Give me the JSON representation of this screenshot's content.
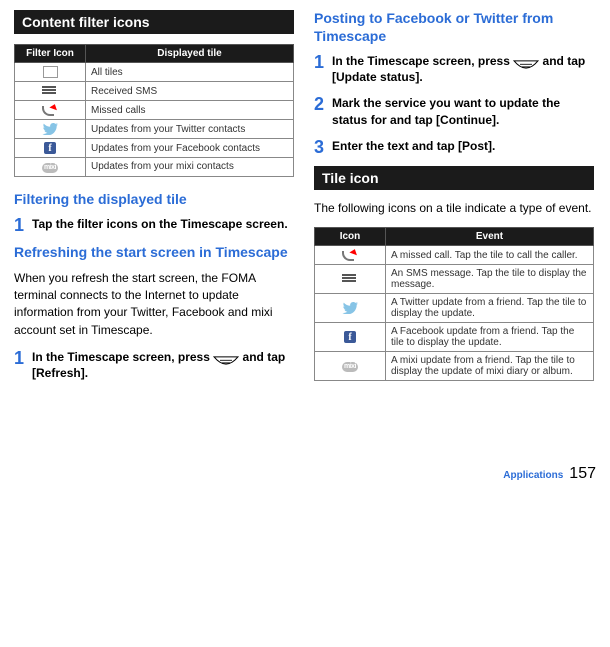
{
  "left": {
    "sectionBar": "Content filter icons",
    "table": {
      "headers": {
        "col1": "Filter Icon",
        "col2": "Displayed tile"
      },
      "rows": [
        {
          "icon": "all-tiles",
          "text": "All tiles"
        },
        {
          "icon": "sms",
          "text": "Received SMS"
        },
        {
          "icon": "missed",
          "text": "Missed calls"
        },
        {
          "icon": "twitter",
          "text": "Updates from your Twitter contacts"
        },
        {
          "icon": "facebook",
          "text": "Updates from your Facebook contacts"
        },
        {
          "icon": "mixi",
          "text": "Updates from your mixi contacts"
        }
      ]
    },
    "filtering": {
      "heading": "Filtering the displayed tile",
      "step1_num": "1",
      "step1_text": "Tap the filter icons on the Timescape screen."
    },
    "refreshing": {
      "heading": "Refreshing the start screen in Timescape",
      "body": "When you refresh the start screen, the FOMA terminal connects to the Internet to update information from your Twitter, Facebook and mixi account set in Timescape.",
      "step1_num": "1",
      "step1_pre": "In the Timescape screen, press ",
      "step1_post": " and tap [Refresh]."
    }
  },
  "right": {
    "posting": {
      "heading": "Posting to Facebook or Twitter from Timescape",
      "step1_num": "1",
      "step1_pre": "In the Timescape screen, press ",
      "step1_post": " and tap [Update status].",
      "step2_num": "2",
      "step2_text": "Mark the service you want to update the status for and tap [Continue].",
      "step3_num": "3",
      "step3_text": "Enter the text and tap [Post]."
    },
    "tileIcon": {
      "bar": "Tile icon",
      "body": "The following icons on a tile indicate a type of event.",
      "table": {
        "headers": {
          "col1": "Icon",
          "col2": "Event"
        },
        "rows": [
          {
            "icon": "missed",
            "text": "A missed call. Tap the tile to call the caller."
          },
          {
            "icon": "sms",
            "text": "An SMS message. Tap the tile to display the message."
          },
          {
            "icon": "twitter",
            "text": "A Twitter update from a friend. Tap the tile to display the update."
          },
          {
            "icon": "facebook",
            "text": "A Facebook update from a friend. Tap the tile to display the update."
          },
          {
            "icon": "mixi",
            "text": "A mixi update from a friend. Tap the tile to display the update of mixi diary or album."
          }
        ]
      }
    }
  },
  "footer": {
    "section": "Applications",
    "page": "157"
  }
}
